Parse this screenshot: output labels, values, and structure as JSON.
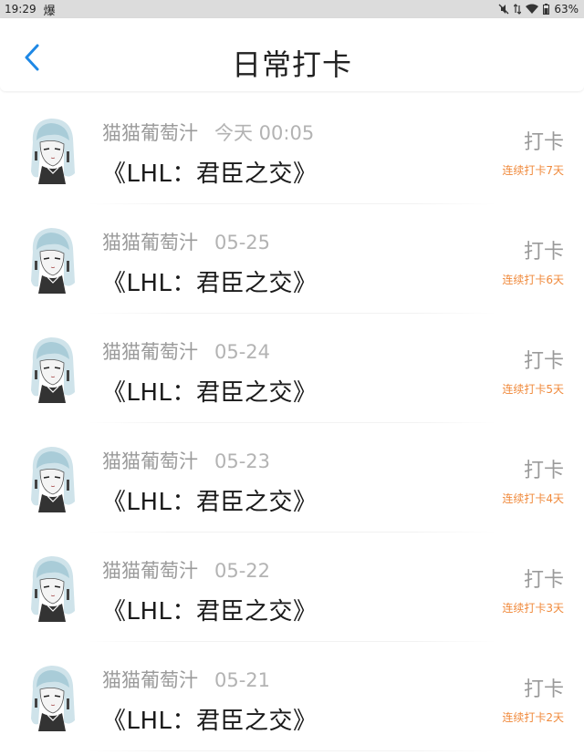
{
  "status": {
    "time": "19:29",
    "app_glyph": "爆",
    "battery": "63%"
  },
  "header": {
    "title": "日常打卡"
  },
  "colors": {
    "accent": "#1e88e5",
    "streak": "#f08a3c"
  },
  "entries": [
    {
      "user": "猫猫葡萄汁",
      "time": "今天 00:05",
      "title": "《LHL：君臣之交》",
      "action": "打卡",
      "streak": "连续打卡7天"
    },
    {
      "user": "猫猫葡萄汁",
      "time": "05-25",
      "title": "《LHL：君臣之交》",
      "action": "打卡",
      "streak": "连续打卡6天"
    },
    {
      "user": "猫猫葡萄汁",
      "time": "05-24",
      "title": "《LHL：君臣之交》",
      "action": "打卡",
      "streak": "连续打卡5天"
    },
    {
      "user": "猫猫葡萄汁",
      "time": "05-23",
      "title": "《LHL：君臣之交》",
      "action": "打卡",
      "streak": "连续打卡4天"
    },
    {
      "user": "猫猫葡萄汁",
      "time": "05-22",
      "title": "《LHL：君臣之交》",
      "action": "打卡",
      "streak": "连续打卡3天"
    },
    {
      "user": "猫猫葡萄汁",
      "time": "05-21",
      "title": "《LHL：君臣之交》",
      "action": "打卡",
      "streak": "连续打卡2天"
    }
  ]
}
